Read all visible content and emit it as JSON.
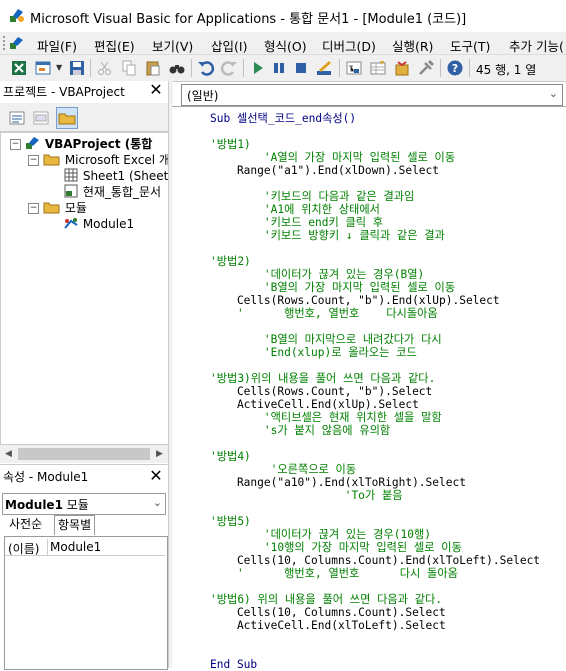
{
  "window": {
    "title": "Microsoft Visual Basic for Applications - 통합 문서1 - [Module1 (코드)]"
  },
  "menu": {
    "items": [
      "파일(F)",
      "편집(E)",
      "보기(V)",
      "삽입(I)",
      "형식(O)",
      "디버그(D)",
      "실행(R)",
      "도구(T)",
      "추가 기능("
    ]
  },
  "toolbar": {
    "status": "45 행, 1 열"
  },
  "project_panel": {
    "title": "프로젝트 - VBAProject",
    "tree": {
      "root": "VBAProject (통합 ",
      "folder_excel": "Microsoft Excel 개",
      "sheet1": "Sheet1 (Sheet",
      "workbook": "현재_통합_문서",
      "folder_modules": "모듈",
      "module1": "Module1"
    }
  },
  "properties_panel": {
    "title": "속성 - Module1",
    "object_name": "Module1",
    "object_type": "모듈",
    "tabs": [
      "사전순",
      "항목별"
    ],
    "rows": [
      {
        "key": "(이름)",
        "value": "Module1"
      }
    ]
  },
  "code_window": {
    "procedure_combo": "(일반)",
    "lines": [
      {
        "t": "kw",
        "s": "Sub 셀선택_코드_end속성()"
      },
      {
        "t": "tx",
        "s": ""
      },
      {
        "t": "cm",
        "s": "'방법1)"
      },
      {
        "t": "cm",
        "s": "        'A열의 가장 마지막 입력된 셀로 이동"
      },
      {
        "t": "tx",
        "s": "    Range(\"a1\").End(xlDown).Select"
      },
      {
        "t": "tx",
        "s": ""
      },
      {
        "t": "cm",
        "s": "        '키보드의 다음과 같은 결과임"
      },
      {
        "t": "cm",
        "s": "        'A1에 위치한 상태에서"
      },
      {
        "t": "cm",
        "s": "        '키보드 end키 클릭 후"
      },
      {
        "t": "cm",
        "s": "        '키보드 방향키 ↓ 클릭과 같은 결과"
      },
      {
        "t": "tx",
        "s": ""
      },
      {
        "t": "cm",
        "s": "'방법2)"
      },
      {
        "t": "cm",
        "s": "        '데이터가 끊겨 있는 경우(B열)"
      },
      {
        "t": "cm",
        "s": "        'B열의 가장 마지막 입력된 셀로 이동"
      },
      {
        "t": "tx",
        "s": "    Cells(Rows.Count, \"b\").End(xlUp).Select"
      },
      {
        "t": "cm",
        "s": "    '      행번호, 열번호    다시돌아옴"
      },
      {
        "t": "tx",
        "s": ""
      },
      {
        "t": "cm",
        "s": "        'B열의 마지막으로 내려갔다가 다시"
      },
      {
        "t": "cm",
        "s": "        'End(xlup)로 올라오는 코드"
      },
      {
        "t": "tx",
        "s": ""
      },
      {
        "t": "cm",
        "s": "'방법3)위의 내용을 풀어 쓰면 다음과 같다."
      },
      {
        "t": "tx",
        "s": "    Cells(Rows.Count, \"b\").Select"
      },
      {
        "t": "tx",
        "s": "    ActiveCell.End(xlUp).Select"
      },
      {
        "t": "cm",
        "s": "        '액티브셀은 현재 위치한 셀을 말함"
      },
      {
        "t": "cm",
        "s": "        's가 붙지 않음에 유의함"
      },
      {
        "t": "tx",
        "s": ""
      },
      {
        "t": "cm",
        "s": "'방법4)"
      },
      {
        "t": "cm",
        "s": "         '오른쪽으로 이동"
      },
      {
        "t": "tx",
        "s": "    Range(\"a10\").End(xlToRight).Select"
      },
      {
        "t": "cm",
        "s": "                    'To가 붙음"
      },
      {
        "t": "tx",
        "s": ""
      },
      {
        "t": "cm",
        "s": "'방법5)"
      },
      {
        "t": "cm",
        "s": "        '데이터가 끊겨 있는 경우(10행)"
      },
      {
        "t": "cm",
        "s": "        '10행의 가장 마지막 입력된 셀로 이동"
      },
      {
        "t": "tx",
        "s": "    Cells(10, Columns.Count).End(xlToLeft).Select"
      },
      {
        "t": "cm",
        "s": "    '      행번호, 열번호      다시 돌아옴"
      },
      {
        "t": "tx",
        "s": ""
      },
      {
        "t": "cm",
        "s": "'방법6) 위의 내용을 풀어 쓰면 다음과 같다."
      },
      {
        "t": "tx",
        "s": "    Cells(10, Columns.Count).Select"
      },
      {
        "t": "tx",
        "s": "    ActiveCell.End(xlToLeft).Select"
      },
      {
        "t": "tx",
        "s": ""
      },
      {
        "t": "tx",
        "s": ""
      },
      {
        "t": "kw",
        "s": "End Sub"
      }
    ]
  },
  "colors": {
    "keyword": "#000080",
    "comment": "#008000",
    "text": "#000000"
  }
}
